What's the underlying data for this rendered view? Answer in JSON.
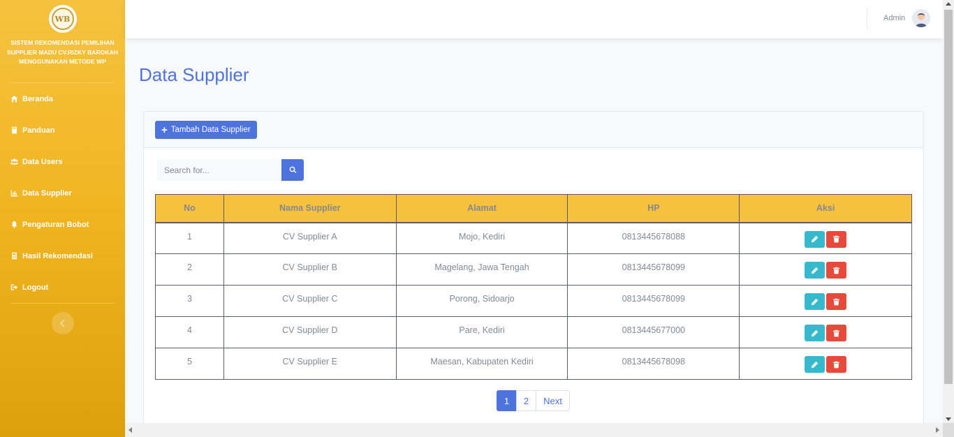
{
  "brand": {
    "logo_text": "WB",
    "title": "SISTEM REKOMENDASI PEMILIHAN SUPPLIER MADU CV.RIZKY BAROKAH MENGGUNAKAN METODE WP"
  },
  "sidebar": {
    "items": [
      {
        "label": "Beranda",
        "icon": "home-icon"
      },
      {
        "label": "Panduan",
        "icon": "book-icon"
      },
      {
        "label": "Data Users",
        "icon": "users-icon"
      },
      {
        "label": "Data Supplier",
        "icon": "chart-icon"
      },
      {
        "label": "Pengaturan Bobot",
        "icon": "bell-icon"
      },
      {
        "label": "Hasil Rekomendasi",
        "icon": "calculator-icon"
      },
      {
        "label": "Logout",
        "icon": "sign-out-icon"
      }
    ]
  },
  "topbar": {
    "user_name": "Admin"
  },
  "page": {
    "title": "Data Supplier"
  },
  "toolbar": {
    "add_label": "Tambah Data Supplier"
  },
  "search": {
    "placeholder": "Search for..."
  },
  "table": {
    "headers": [
      "No",
      "Nama Supplier",
      "Alamat",
      "HP",
      "Aksi"
    ],
    "rows": [
      {
        "no": "1",
        "nama": "CV Supplier A",
        "alamat": "Mojo, Kediri",
        "hp": "0813445678088"
      },
      {
        "no": "2",
        "nama": "CV Supplier B",
        "alamat": "Magelang, Jawa Tengah",
        "hp": "0813445678099"
      },
      {
        "no": "3",
        "nama": "CV Supplier C",
        "alamat": "Porong, Sidoarjo",
        "hp": "0813445678099"
      },
      {
        "no": "4",
        "nama": "CV Supplier D",
        "alamat": "Pare, Kediri",
        "hp": "0813445677000"
      },
      {
        "no": "5",
        "nama": "CV Supplier E",
        "alamat": "Maesan, Kabupaten Kediri",
        "hp": "0813445678098"
      }
    ]
  },
  "pagination": {
    "pages": [
      "1",
      "2"
    ],
    "next_label": "Next",
    "current": "1"
  },
  "colors": {
    "primary": "#4e73df",
    "warning": "#f6c23e",
    "info": "#36b9cc",
    "danger": "#e74a3b"
  }
}
